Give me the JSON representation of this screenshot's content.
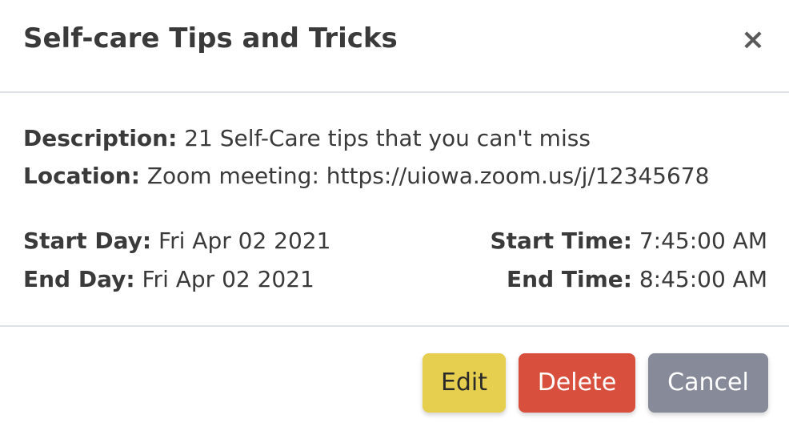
{
  "modal": {
    "title": "Self-care Tips and Tricks",
    "close_icon": "×"
  },
  "details": {
    "description_label": "Description:",
    "description_value": "21 Self-Care tips that you can't miss",
    "location_label": "Location:",
    "location_value": "Zoom meeting: https://uiowa.zoom.us/j/12345678",
    "start_day_label": "Start Day:",
    "start_day_value": "Fri Apr 02 2021",
    "end_day_label": "End Day:",
    "end_day_value": "Fri Apr 02 2021",
    "start_time_label": "Start Time:",
    "start_time_value": "7:45:00 AM",
    "end_time_label": "End Time:",
    "end_time_value": "8:45:00 AM"
  },
  "footer": {
    "edit_label": "Edit",
    "delete_label": "Delete",
    "cancel_label": "Cancel"
  },
  "colors": {
    "edit": "#e6cf4e",
    "delete": "#d94f3d",
    "cancel": "#868a99"
  }
}
